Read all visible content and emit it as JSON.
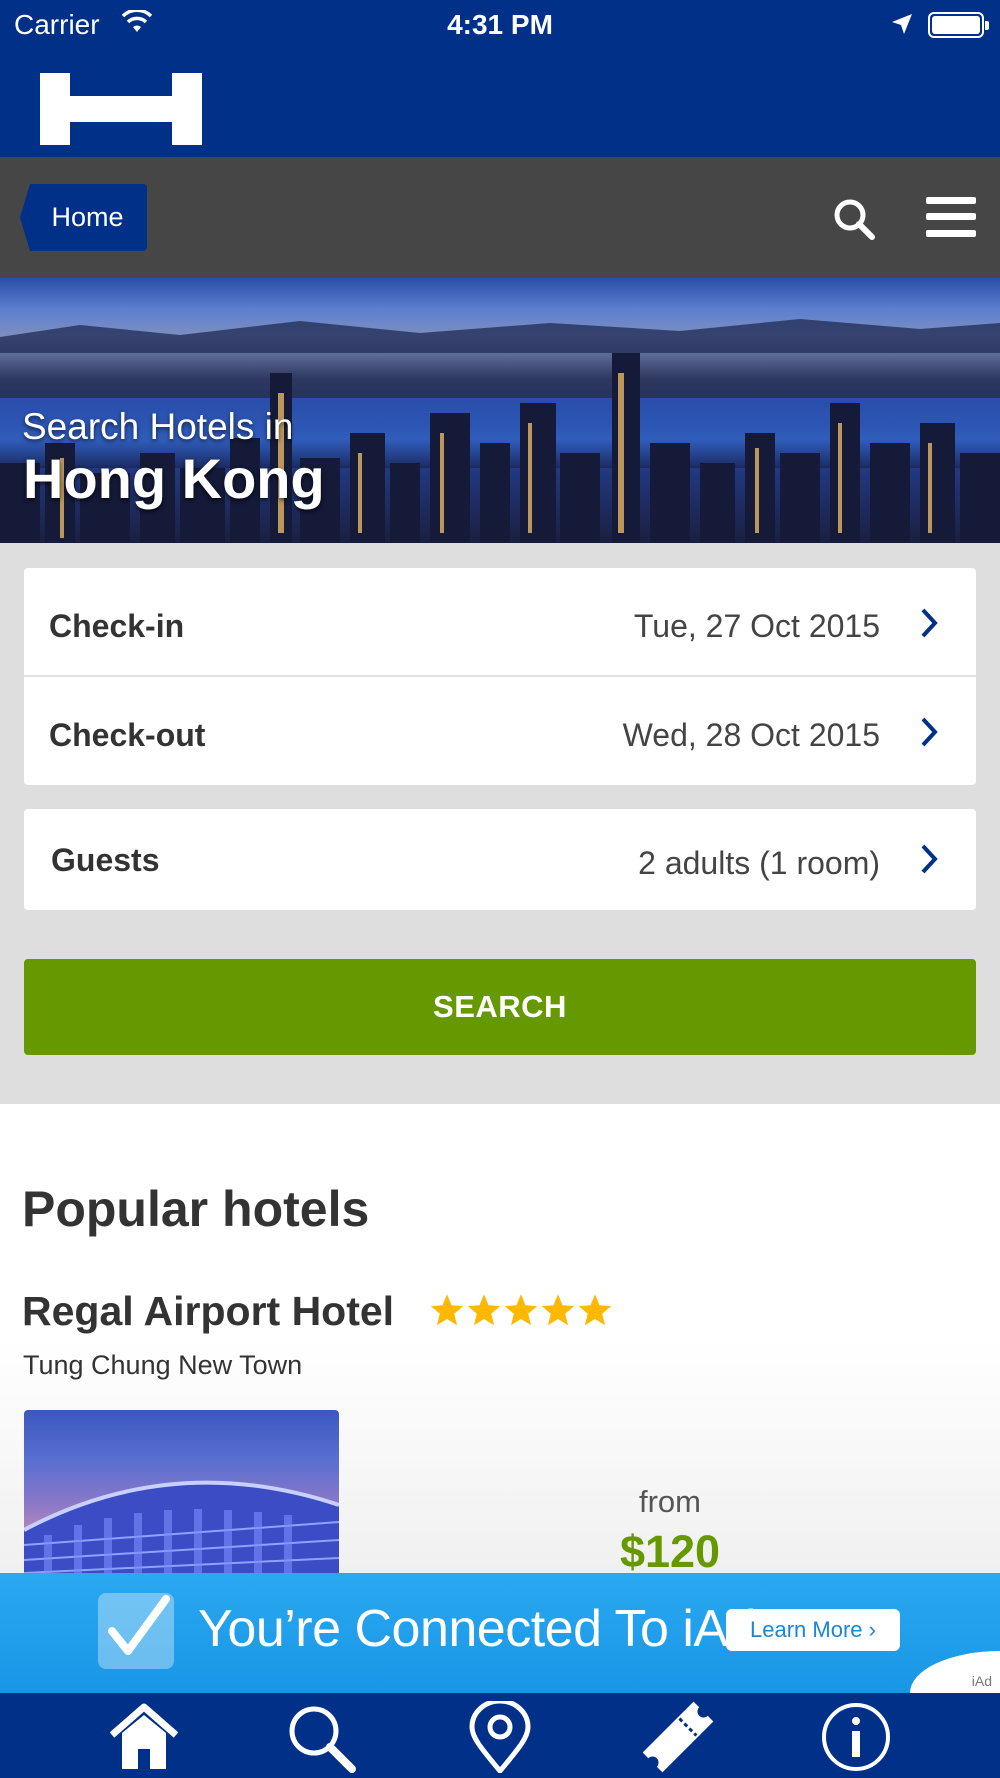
{
  "status_bar": {
    "carrier": "Carrier",
    "time": "4:31 PM"
  },
  "nav": {
    "home_label": "Home"
  },
  "hero": {
    "subtitle": "Search Hotels in",
    "city": "Hong Kong"
  },
  "booking": {
    "checkin_label": "Check-in",
    "checkin_value": "Tue, 27 Oct 2015",
    "checkout_label": "Check-out",
    "checkout_value": "Wed, 28 Oct 2015",
    "guests_label": "Guests",
    "guests_value": "2 adults (1 room)",
    "search_label": "SEARCH"
  },
  "popular": {
    "heading": "Popular hotels",
    "hotel": {
      "name": "Regal Airport Hotel",
      "stars": 5,
      "area": "Tung Chung New Town",
      "from_label": "from",
      "price": "$120"
    }
  },
  "ad": {
    "text": "You’re Connected To iAd",
    "button": "Learn More ›",
    "tag": "iAd"
  },
  "tabs": [
    {
      "icon": "home-icon"
    },
    {
      "icon": "search-icon"
    },
    {
      "icon": "location-pin-icon"
    },
    {
      "icon": "ticket-icon"
    },
    {
      "icon": "info-icon"
    }
  ],
  "colors": {
    "brand_blue": "#003087",
    "nav_gray": "#464646",
    "accent_green": "#669900",
    "star_yellow": "#FFB800",
    "ad_blue": "#1996E6"
  }
}
